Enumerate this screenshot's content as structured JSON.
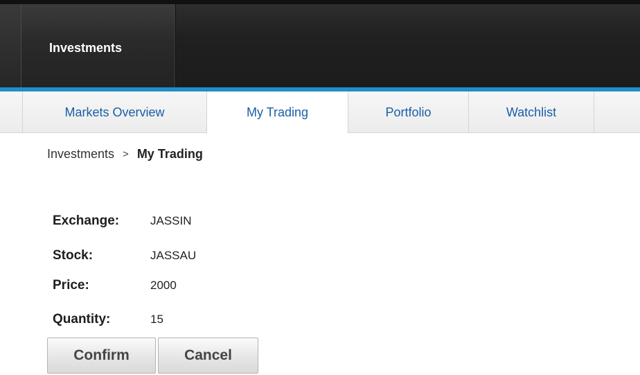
{
  "header": {
    "app_tab": "Investments"
  },
  "nav": {
    "tabs": [
      {
        "label": "Markets Overview",
        "active": false
      },
      {
        "label": "My Trading",
        "active": true
      },
      {
        "label": "Portfolio",
        "active": false
      },
      {
        "label": "Watchlist",
        "active": false
      }
    ]
  },
  "breadcrumb": {
    "root": "Investments",
    "separator": ">",
    "current": "My Trading"
  },
  "order": {
    "exchange_label": "Exchange:",
    "exchange_value": "JASSIN",
    "stock_label": "Stock:",
    "stock_value": "JASSAU",
    "price_label": "Price:",
    "price_value": "2000",
    "quantity_label": "Quantity:",
    "quantity_value": "15"
  },
  "actions": {
    "confirm_label": "Confirm",
    "cancel_label": "Cancel"
  },
  "colors": {
    "accent": "#1f8fc9",
    "header_bg": "#1c1c1c",
    "link": "#1a5ea8"
  }
}
